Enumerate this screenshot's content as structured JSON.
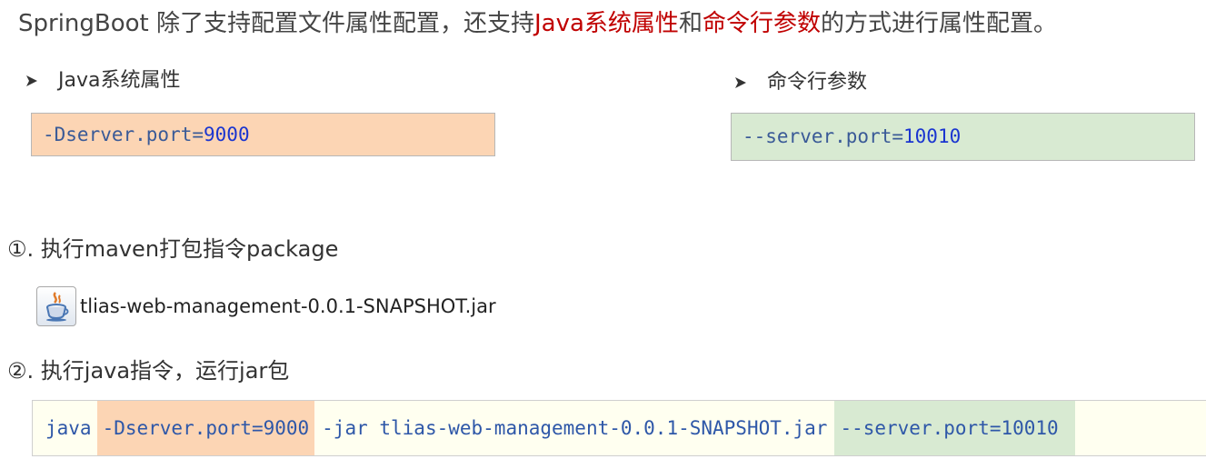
{
  "heading": {
    "part1": "SpringBoot 除了支持配置文件属性配置，还支持",
    "java_props": "Java系统属性",
    "and": "和",
    "cmd_args": "命令行参数",
    "part2": "的方式进行属性配置。"
  },
  "left_section": {
    "label": "Java系统属性",
    "code_prefix": "-Dserver.port=",
    "code_value": "9000"
  },
  "right_section": {
    "label": "命令行参数",
    "code_prefix": "--server.port=",
    "code_value": "10010"
  },
  "step1": {
    "label": "①. 执行maven打包指令package",
    "jar_file": "tlias-web-management-0.0.1-SNAPSHOT.jar"
  },
  "step2": {
    "label": "②. 执行java指令，运行jar包"
  },
  "command": {
    "java": "java",
    "system_prop": "-Dserver.port=9000",
    "jar_part": "-jar tlias-web-management-0.0.1-SNAPSHOT.jar",
    "cmd_arg": "--server.port=10010"
  },
  "colors": {
    "highlight_red": "#c00000",
    "orange_box": "#fcd5b4",
    "green_box": "#d8ead2",
    "code_blue": "#2e57a8"
  },
  "icons": {
    "bullet": "arrow-bullet-icon",
    "jar": "java-jar-icon"
  }
}
